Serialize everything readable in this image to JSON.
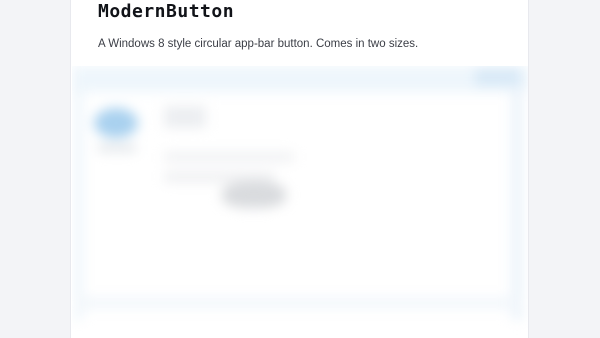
{
  "component": {
    "title": "ModernButton",
    "description": "A Windows 8 style circular app-bar button. Comes in two sizes."
  },
  "colors": {
    "page_background": "#f3f4f7",
    "card_background": "#ffffff",
    "title_text": "#111318",
    "body_text": "#3b3e46",
    "preview_accent": "#a9d1ef"
  }
}
